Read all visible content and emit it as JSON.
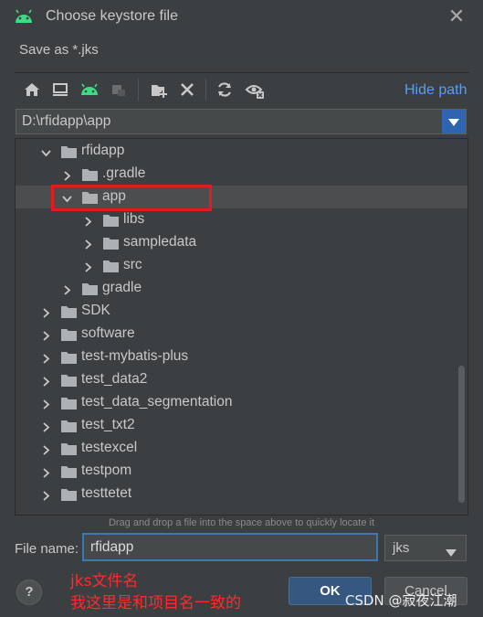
{
  "window": {
    "title": "Choose keystore file",
    "subtitle": "Save as *.jks"
  },
  "toolbar": {
    "icons": [
      "home-icon",
      "desktop-icon",
      "android-project-icon",
      "module-icon",
      "new-folder-icon",
      "delete-icon",
      "refresh-icon",
      "show-hidden-icon"
    ],
    "hide_path": "Hide path"
  },
  "path": {
    "value": "D:\\rfidapp\\app"
  },
  "tree": {
    "rows": [
      {
        "label": "rfidapp",
        "depth": 1,
        "expanded": true
      },
      {
        "label": ".gradle",
        "depth": 2,
        "expanded": false
      },
      {
        "label": "app",
        "depth": 2,
        "expanded": true,
        "selected": true
      },
      {
        "label": "libs",
        "depth": 3,
        "expanded": false
      },
      {
        "label": "sampledata",
        "depth": 3,
        "expanded": false
      },
      {
        "label": "src",
        "depth": 3,
        "expanded": false
      },
      {
        "label": "gradle",
        "depth": 2,
        "expanded": false
      },
      {
        "label": "SDK",
        "depth": 1,
        "expanded": false
      },
      {
        "label": "software",
        "depth": 1,
        "expanded": false
      },
      {
        "label": "test-mybatis-plus",
        "depth": 1,
        "expanded": false
      },
      {
        "label": "test_data2",
        "depth": 1,
        "expanded": false
      },
      {
        "label": "test_data_segmentation",
        "depth": 1,
        "expanded": false
      },
      {
        "label": "test_txt2",
        "depth": 1,
        "expanded": false
      },
      {
        "label": "testexcel",
        "depth": 1,
        "expanded": false
      },
      {
        "label": "testpom",
        "depth": 1,
        "expanded": false
      },
      {
        "label": "testtetet",
        "depth": 1,
        "expanded": false
      }
    ]
  },
  "hint": "Drag and drop a file into the space above to quickly locate it",
  "file_name": {
    "label": "File name:",
    "value": "rfidapp"
  },
  "extension": {
    "value": "jks"
  },
  "annotation": {
    "line1": "jks文件名",
    "line2": "我这里是和项目名一致的"
  },
  "buttons": {
    "help": "?",
    "ok": "OK",
    "cancel": "Cancel"
  },
  "watermark": "CSDN @寂夜江潮",
  "colors": {
    "accent": "#589df6",
    "selection": "#4b4d4f",
    "highlight": "#e01c1c",
    "ok_button": "#365880"
  }
}
